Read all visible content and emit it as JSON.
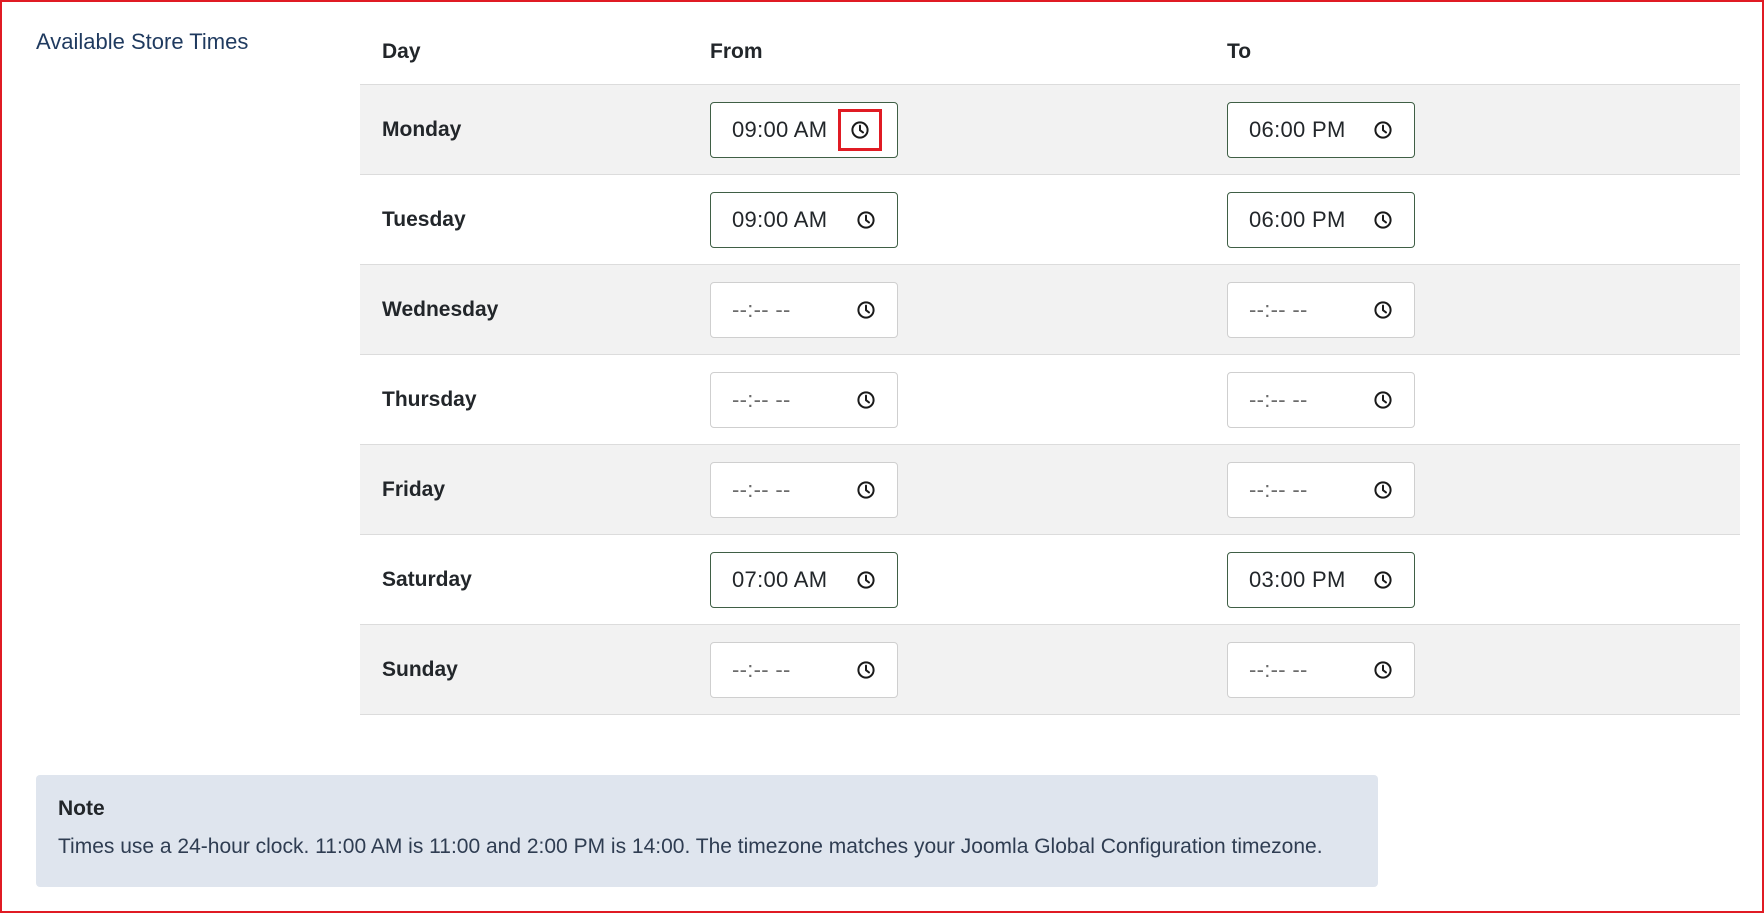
{
  "section": {
    "label": "Available Store Times"
  },
  "table": {
    "headers": {
      "day": "Day",
      "from": "From",
      "to": "To"
    },
    "rows": [
      {
        "day": "Monday",
        "from": "09:00 AM",
        "to": "06:00 PM"
      },
      {
        "day": "Tuesday",
        "from": "09:00 AM",
        "to": "06:00 PM"
      },
      {
        "day": "Wednesday",
        "from": "--:-- --",
        "to": "--:-- --"
      },
      {
        "day": "Thursday",
        "from": "--:-- --",
        "to": "--:-- --"
      },
      {
        "day": "Friday",
        "from": "--:-- --",
        "to": "--:-- --"
      },
      {
        "day": "Saturday",
        "from": "07:00 AM",
        "to": "03:00 PM"
      },
      {
        "day": "Sunday",
        "from": "--:-- --",
        "to": "--:-- --"
      }
    ]
  },
  "note": {
    "title": "Note",
    "text": "Times use a 24-hour clock. 11:00 AM is 11:00 and 2:00 PM is 14:00. The timezone matches your Joomla Global Configuration timezone."
  },
  "icons": {
    "time_picker": "clock-icon"
  },
  "colors": {
    "frame_border": "#e01b24",
    "highlight": "#e01b24",
    "note_background": "#dfe5ee",
    "filled_input_border": "#3f5f45",
    "stripe": "#f2f2f2"
  }
}
